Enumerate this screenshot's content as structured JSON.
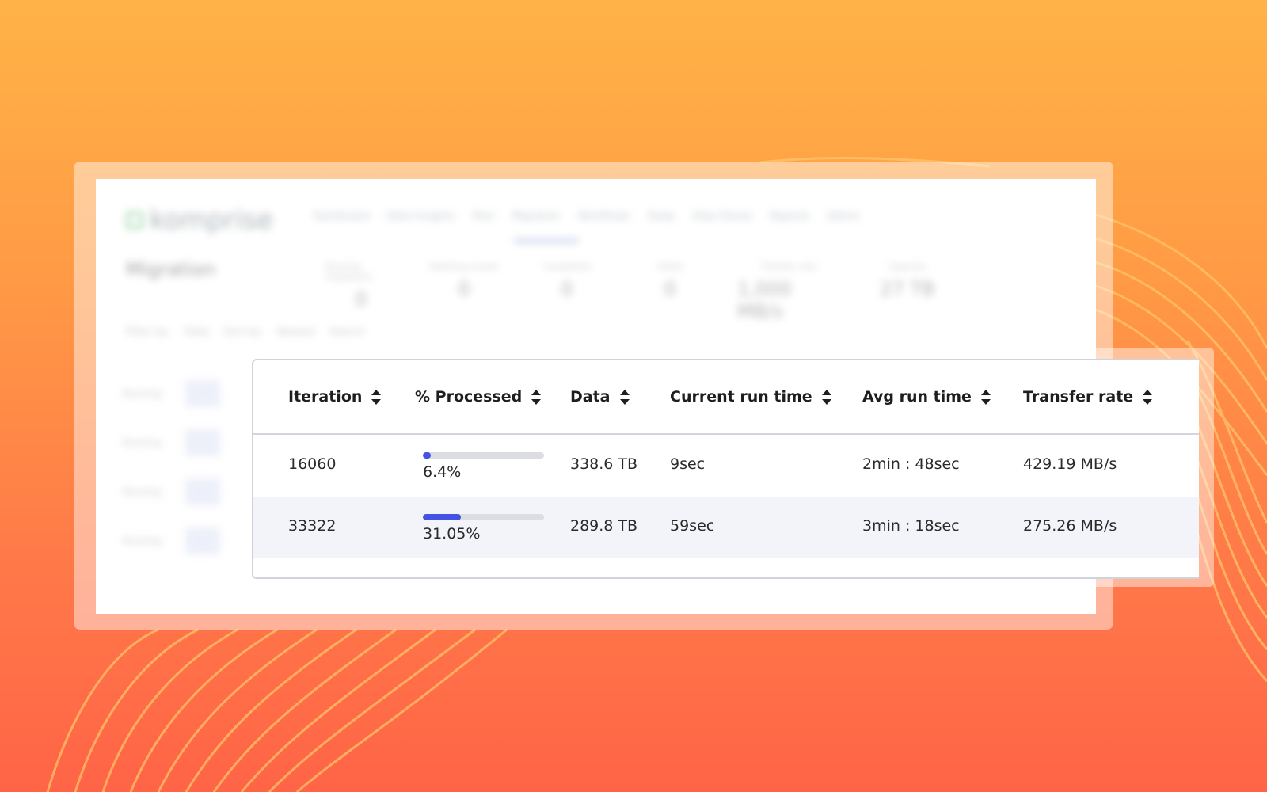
{
  "background_app": {
    "logo_text": "komprise",
    "nav_items": [
      "Dashboard",
      "Data Insights",
      "Plan",
      "Migration",
      "Workflows",
      "Deep",
      "Data Stores",
      "Reports",
      "Admin"
    ],
    "page_title": "Migration",
    "stats": [
      {
        "label": "Running migrations",
        "value": "0"
      },
      {
        "label": "Awaiting review",
        "value": "0"
      },
      {
        "label": "Completed",
        "value": "0"
      },
      {
        "label": "Failed",
        "value": "0"
      },
      {
        "label": "Transfer rate",
        "value": "1,000 MB/s"
      },
      {
        "label": "Capacity",
        "value": "27 TB"
      }
    ],
    "filters": [
      "Filter by:",
      "Data",
      "Sort by:",
      "Newest",
      "Search"
    ],
    "side_rows": [
      "Running",
      "Running",
      "Running",
      "Running"
    ]
  },
  "table": {
    "columns": [
      {
        "label": "Iteration"
      },
      {
        "label": "% Processed"
      },
      {
        "label": "Data"
      },
      {
        "label": "Current run time"
      },
      {
        "label": "Avg run time"
      },
      {
        "label": "Transfer rate"
      }
    ],
    "rows": [
      {
        "iteration": "16060",
        "processed_pct": 6.4,
        "processed_label": "6.4%",
        "data": "338.6 TB",
        "current_run_time": "9sec",
        "avg_run_time": "2min : 48sec",
        "transfer_rate": "429.19 MB/s"
      },
      {
        "iteration": "33322",
        "processed_pct": 31.05,
        "processed_label": "31.05%",
        "data": "289.8 TB",
        "current_run_time": "59sec",
        "avg_run_time": "3min : 18sec",
        "transfer_rate": "275.26 MB/s"
      }
    ]
  },
  "colors": {
    "progress_fill": "#4453e3",
    "progress_track": "#dcdde1",
    "row_alt": "#f3f4f9",
    "bg_top": "#ffb347",
    "bg_bottom": "#ff6447"
  }
}
